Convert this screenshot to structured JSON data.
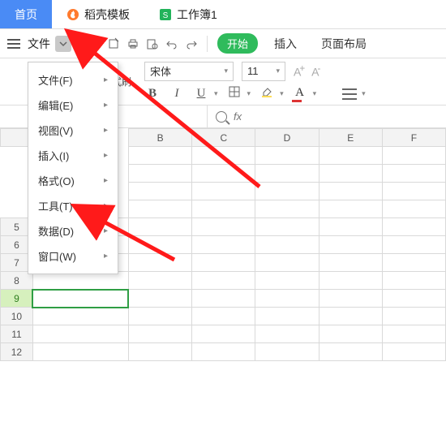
{
  "tabs": {
    "home": "首页",
    "template": "稻壳模板",
    "workbook": "工作簿1"
  },
  "quick": {
    "file": "文件"
  },
  "ribbon": {
    "start": "开始",
    "insert": "插入",
    "pagelayout": "页面布局",
    "brush": "式刷"
  },
  "font": {
    "name": "宋体",
    "size": "11"
  },
  "fx": {
    "label": "fx"
  },
  "cols": {
    "B": "B",
    "C": "C",
    "D": "D",
    "E": "E",
    "F": "F"
  },
  "rows": {
    "r5": "5",
    "r6": "6",
    "r7": "7",
    "r8": "8",
    "r9": "9",
    "r10": "10",
    "r11": "11",
    "r12": "12"
  },
  "menu": {
    "file": "文件(F)",
    "edit": "编辑(E)",
    "view": "视图(V)",
    "insert": "插入(I)",
    "format": "格式(O)",
    "tools": "工具(T)",
    "data": "数据(D)",
    "window": "窗口(W)"
  }
}
